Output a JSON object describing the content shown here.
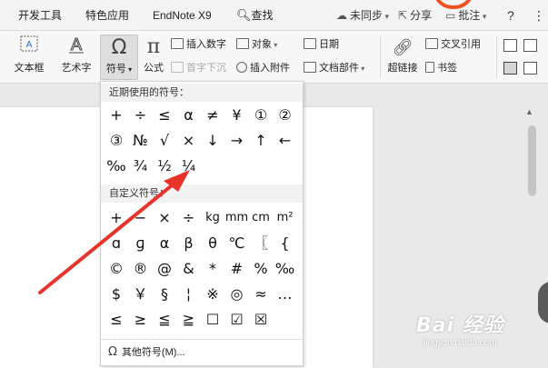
{
  "tabs": [
    {
      "label": "开发工具"
    },
    {
      "label": "特色应用"
    },
    {
      "label": "EndNote X9"
    },
    {
      "label": "查找"
    }
  ],
  "topbar": {
    "sync_label": "未同步",
    "share_label": "分享",
    "comment_label": "批注",
    "help_label": "?",
    "more_label": "⋮"
  },
  "ribbon": {
    "textbox_label": "文本框",
    "wordart_label": "艺术字",
    "symbol_label": "符号",
    "formula_label": "公式",
    "insert_number_label": "插入数字",
    "object_label": "对象",
    "date_label": "日期",
    "dropcap_label": "首字下沉",
    "attachment_label": "插入附件",
    "docpart_label": "文档部件",
    "hyperlink_label": "超链接",
    "crossref_label": "交叉引用",
    "bookmark_label": "书签"
  },
  "icons": {
    "textbox": "textbox-icon",
    "wordart": "wordart-icon",
    "symbol": "omega-icon",
    "formula": "pi-icon",
    "hyperlink": "chain-icon",
    "search": "search-icon"
  },
  "symbol_panel": {
    "recent_title": "近期使用的符号：",
    "recent_symbols": [
      "+",
      "÷",
      "≤",
      "α",
      "≠",
      "¥",
      "①",
      "②",
      "③",
      "№",
      "√",
      "×",
      "↓",
      "→",
      "↑",
      "←",
      "‰",
      "¾",
      "½",
      "¼"
    ],
    "custom_title": "自定义符号：",
    "custom_symbols": [
      "+",
      "−",
      "×",
      "÷",
      "kg",
      "mm",
      "cm",
      "m²",
      "ɑ",
      "ɡ",
      "α",
      "β",
      "θ",
      "℃",
      "〖",
      "{",
      "©",
      "®",
      "@",
      "&",
      "*",
      "#",
      "%",
      "‰",
      "$",
      "￥",
      "§",
      "¦",
      "※",
      "◎",
      "≈",
      "…",
      "≤",
      "≥",
      "≦",
      "≧",
      "☐",
      "☑",
      "☒"
    ],
    "more_label": "其他符号(M)...",
    "more_icon": "Ω"
  },
  "colors": {
    "annotation_arrow": "#e8332a",
    "accent_orange": "#f0501e"
  },
  "watermark": {
    "main": "Bai 经验",
    "sub": "jingyan.baidu.com"
  }
}
